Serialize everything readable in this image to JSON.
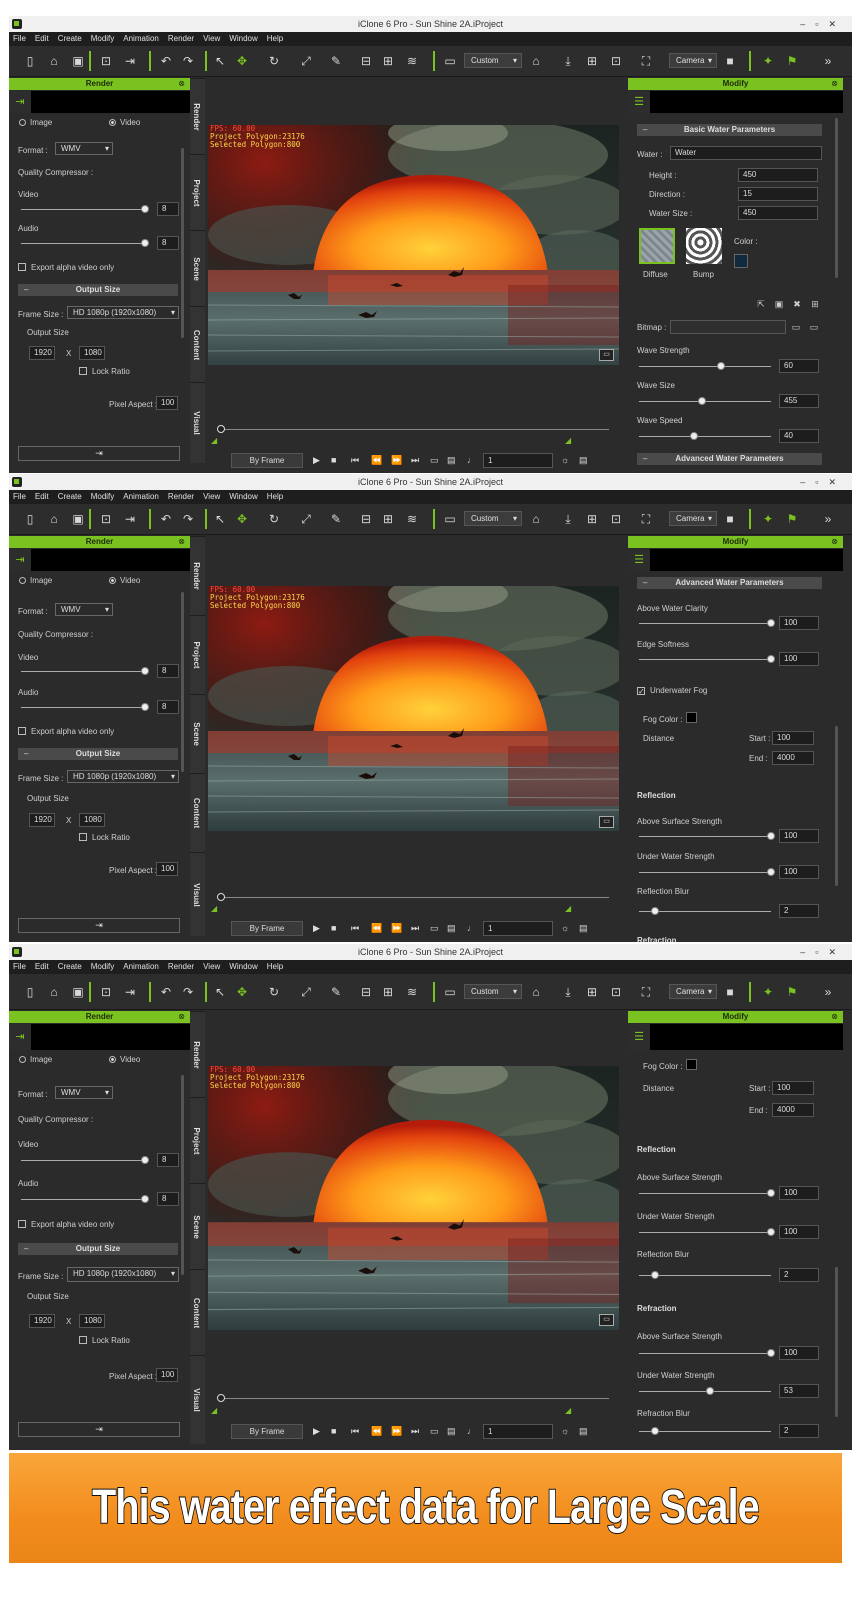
{
  "app": {
    "title": "iClone 6 Pro - Sun Shine 2A.iProject",
    "menu": [
      "File",
      "Edit",
      "Create",
      "Modify",
      "Animation",
      "Render",
      "View",
      "Window",
      "Help"
    ],
    "toolbar": {
      "view_mode": "Custom",
      "camera": "Camera"
    }
  },
  "render_panel": {
    "title": "Render",
    "image_label": "Image",
    "video_label": "Video",
    "format_label": "Format :",
    "format_value": "WMV",
    "quality_label": "Quality Compressor :",
    "video_label2": "Video",
    "video_value": "8",
    "audio_label": "Audio",
    "audio_value": "8",
    "export_alpha": "Export alpha video only",
    "output_size_header": "Output Size",
    "frame_size_label": "Frame Size :",
    "frame_size_value": "HD 1080p (1920x1080)",
    "output_size_label": "Output Size",
    "width": "1920",
    "x": "X",
    "height": "1080",
    "lock_ratio": "Lock Ratio",
    "pixel_aspect_label": "Pixel Aspect :",
    "pixel_aspect_value": "100"
  },
  "side_tabs": [
    "Render",
    "Project",
    "Scene",
    "Content",
    "Visual"
  ],
  "viewport": {
    "fps": "FPS: 60.00",
    "polygons": "Project Polygon:23176",
    "selected": "Selected Polygon:800"
  },
  "playback": {
    "mode": "By Frame",
    "frame": "1"
  },
  "modify_panel": {
    "title": "Modify",
    "basic": {
      "header": "Basic Water Parameters",
      "water_label": "Water :",
      "water_value": "Water",
      "height_label": "Height :",
      "height_value": "450",
      "direction_label": "Direction :",
      "direction_value": "15",
      "water_size_label": "Water Size :",
      "water_size_value": "450",
      "diffuse": "Diffuse",
      "bump": "Bump",
      "color_label": "Color :",
      "color": "#102a3e",
      "bitmap_label": "Bitmap :",
      "wave_strength_label": "Wave Strength",
      "wave_strength_value": "60",
      "wave_size_label": "Wave Size",
      "wave_size_value": "455",
      "wave_speed_label": "Wave Speed",
      "wave_speed_value": "40"
    },
    "advanced": {
      "header": "Advanced Water Parameters",
      "above_clarity_label": "Above Water Clarity",
      "above_clarity_value": "100",
      "edge_softness_label": "Edge Softness",
      "edge_softness_value": "100",
      "underwater_fog": "Underwater Fog",
      "fog_color_label": "Fog Color :",
      "distance_label": "Distance",
      "start_label": "Start :",
      "start_value": "100",
      "end_label": "End :",
      "end_value": "4000"
    },
    "reflection": {
      "header": "Reflection",
      "above_label": "Above Surface Strength",
      "above_value": "100",
      "under_label": "Under Water Strength",
      "under_value": "100",
      "blur_label": "Reflection Blur",
      "blur_value": "2"
    },
    "refraction": {
      "header": "Refraction",
      "above_label": "Above Surface Strength",
      "above_value": "100",
      "under_label": "Under Water Strength",
      "under_value": "53",
      "blur_label": "Refraction Blur",
      "blur_value": "2"
    }
  },
  "banner": {
    "text": "This water effect data for Large Scale"
  }
}
